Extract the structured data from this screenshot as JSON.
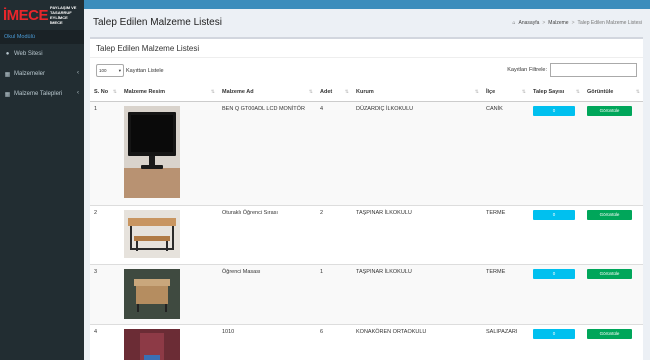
{
  "logo": {
    "big": "İMECE",
    "line1": "PAYLAŞIM VE TASARRUF",
    "line2": "EYLİMCE İMECE"
  },
  "sidebar": {
    "section": "Okul Modülü",
    "items": [
      {
        "label": "Web Sitesi",
        "icon": "globe-icon",
        "arrow": false
      },
      {
        "label": "Malzemeler",
        "icon": "boxes-icon",
        "arrow": true
      },
      {
        "label": "Malzeme Talepleri",
        "icon": "boxes-icon",
        "arrow": true
      }
    ]
  },
  "header": {
    "title": "Talep Edilen Malzeme Listesi",
    "breadcrumb": [
      "Anasayfa",
      "Malzeme",
      "Talep Edilen Malzeme Listesi"
    ]
  },
  "box": {
    "title": "Talep Edilen Malzeme Listesi",
    "length_value": "100",
    "length_label": "Kayıttan Listele",
    "filter_label": "Kayıtları Filtrele:",
    "filter_value": ""
  },
  "table": {
    "headers": [
      "S. No",
      "Malzeme Resim",
      "Malzeme Ad",
      "Adet",
      "Kurum",
      "İlçe",
      "Talep Sayısı",
      "Görüntüle"
    ],
    "rows": [
      {
        "no": "1",
        "name": "BEN Q GT00ADL LCD MONİTÖR",
        "qty": "4",
        "kurum": "DÜZARDIÇ İLKOKULU",
        "ilce": "CANİK",
        "talep": "0",
        "view": "Görüntüle",
        "img": "monitor"
      },
      {
        "no": "2",
        "name": "Oturaklı Öğrenci Sırası",
        "qty": "2",
        "kurum": "TAŞPINAR İLKOKULU",
        "ilce": "TERME",
        "talep": "0",
        "view": "Görüntüle",
        "img": "desk"
      },
      {
        "no": "3",
        "name": "Öğrenci Masası",
        "qty": "1",
        "kurum": "TAŞPINAR İLKOKULU",
        "ilce": "TERME",
        "talep": "0",
        "view": "Görüntüle",
        "img": "table"
      },
      {
        "no": "4",
        "name": "1010",
        "qty": "6",
        "kurum": "KONAKÖREN ORTAOKULU",
        "ilce": "SALIPAZARI",
        "talep": "0",
        "view": "Görüntüle",
        "img": "chair"
      }
    ]
  },
  "colors": {
    "sidebar": "#222d32",
    "topbar": "#3c8dbc",
    "talep_btn": "#00c0ef",
    "view_btn": "#00a65a",
    "logo_red": "#e8262b"
  }
}
